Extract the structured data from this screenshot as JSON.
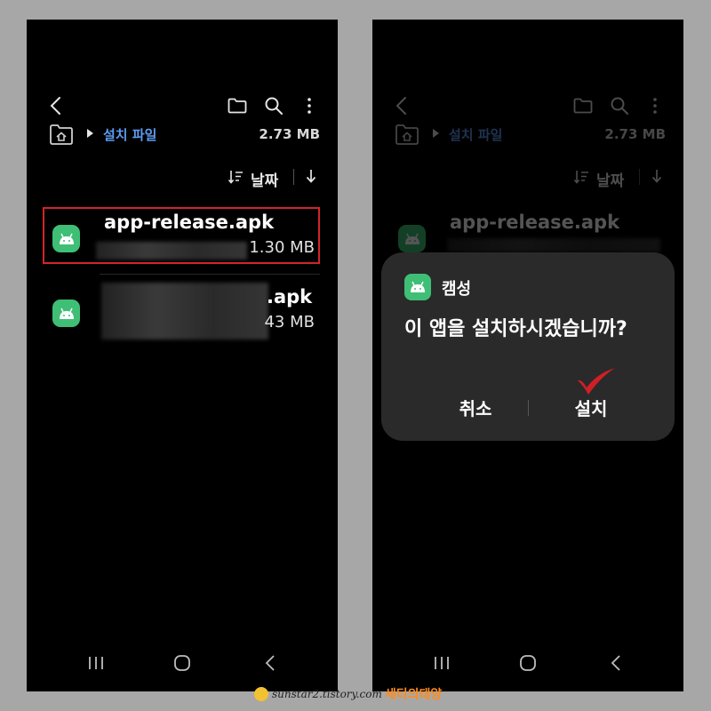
{
  "left_screen": {
    "path": {
      "folder": "설치 파일",
      "size": "2.73 MB"
    },
    "sort": {
      "label": "날짜"
    },
    "files": [
      {
        "name": "app-release.apk",
        "size": "1.30 MB",
        "highlighted": true
      },
      {
        "name_visible": ".apk",
        "size_visible": "43 MB"
      }
    ]
  },
  "right_screen": {
    "path": {
      "folder": "설치 파일",
      "size": "2.73 MB"
    },
    "sort": {
      "label": "날짜"
    },
    "files": [
      {
        "name": "app-release.apk"
      }
    ],
    "dialog": {
      "app_name": "캠성",
      "message": "이 앱을 설치하시겠습니까?",
      "cancel_label": "취소",
      "install_label": "설치"
    }
  },
  "watermark": {
    "url": "sunstar2.tistory.com",
    "name": "세티의태양"
  },
  "colors": {
    "accent_blue": "#5d9bf0",
    "android_green": "#3fbf76",
    "highlight_red": "#d3242a",
    "check_red": "#d01f26"
  },
  "icons": [
    "back-icon",
    "folder-icon",
    "search-icon",
    "more-icon",
    "home-icon",
    "sort-icon",
    "sort-direction-icon",
    "android-icon",
    "recent-apps-icon",
    "nav-home-icon",
    "nav-back-icon",
    "checkmark-icon"
  ]
}
